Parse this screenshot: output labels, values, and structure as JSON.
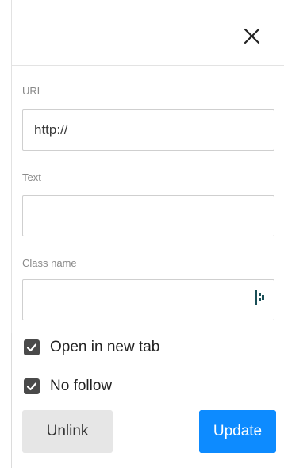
{
  "colors": {
    "primary_button": "#0d8bff",
    "secondary_button": "#e6e6e6",
    "checkbox_fill": "#4a4a4a",
    "label_text": "#8a8a8a",
    "input_border": "#cfcfcf"
  },
  "header": {
    "close_icon": "close-icon"
  },
  "form": {
    "url": {
      "label": "URL",
      "placeholder": "http://",
      "value": ""
    },
    "text": {
      "label": "Text",
      "placeholder": "",
      "value": ""
    },
    "class_name": {
      "label": "Class name",
      "placeholder": "",
      "value": "",
      "extension_icon": "bitwarden-icon"
    }
  },
  "options": {
    "open_in_new_tab": {
      "label": "Open in new tab",
      "checked": true
    },
    "no_follow": {
      "label": "No follow",
      "checked": true
    }
  },
  "actions": {
    "unlink_label": "Unlink",
    "update_label": "Update"
  }
}
